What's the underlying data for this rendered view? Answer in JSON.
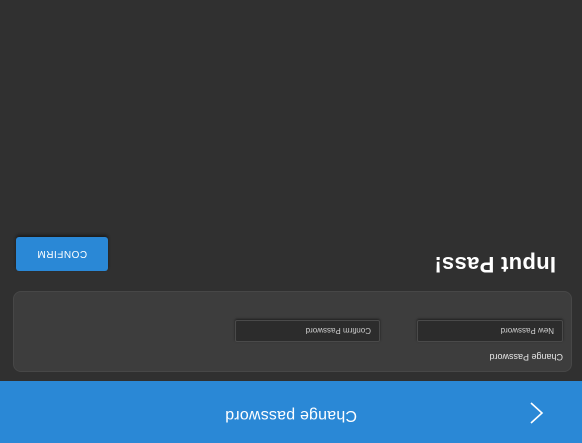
{
  "header": {
    "title": "Change password",
    "back_icon": "chevron-right-icon"
  },
  "card": {
    "title": "Change Password",
    "new_password": {
      "placeholder": "New Password",
      "value": ""
    },
    "confirm_password": {
      "placeholder": "Confirm Password",
      "value": ""
    }
  },
  "heading": "Input Pass!",
  "confirm_button": {
    "label": "CONFIRM"
  },
  "colors": {
    "accent": "#2a88d6",
    "background": "#303030",
    "card": "#3d3d3d",
    "text": "#ffffff"
  }
}
